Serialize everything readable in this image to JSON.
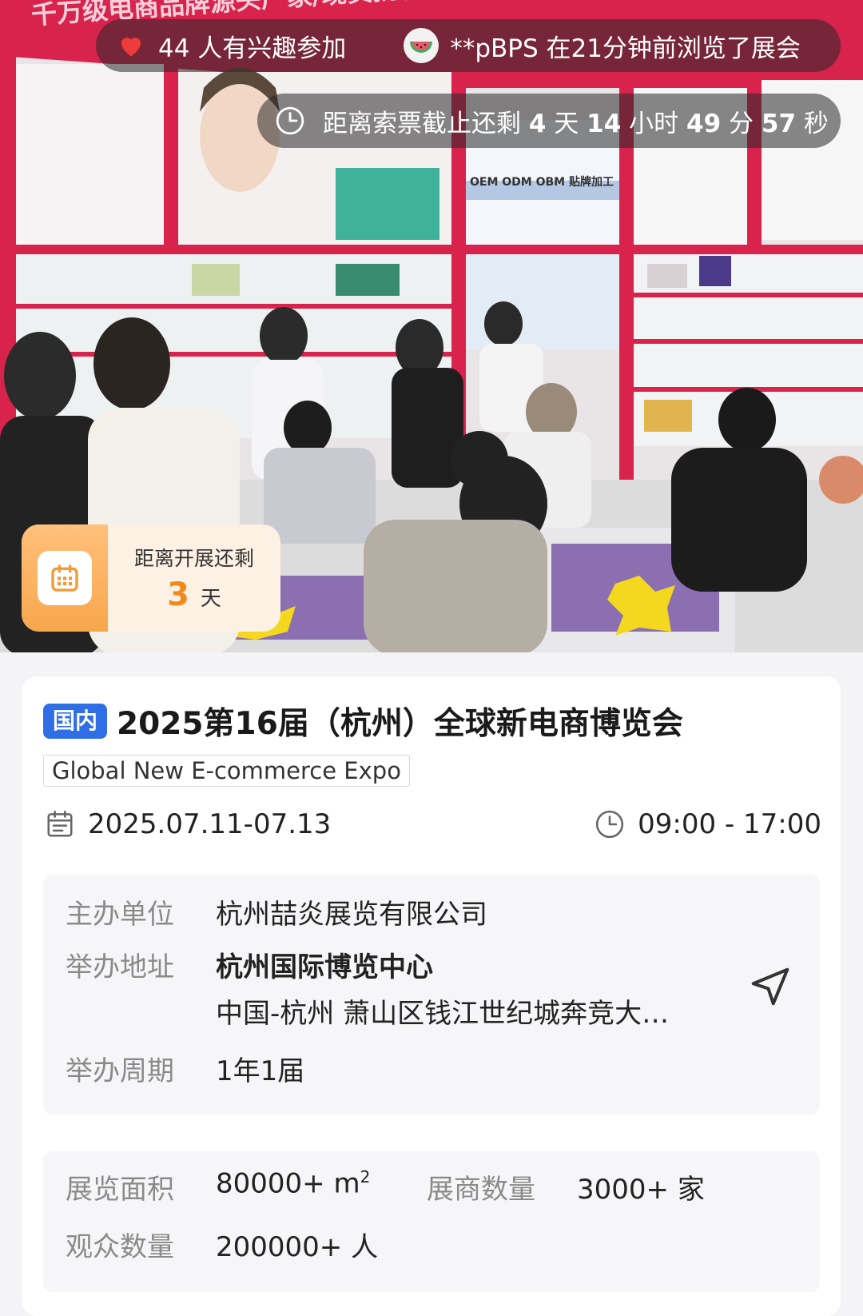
{
  "hero": {
    "interest_count": "44 人有兴趣参加",
    "browse_text": "**pBPS 在21分钟前浏览了展会",
    "ticket_countdown": {
      "prefix": "距离索票截止还剩",
      "days": "4",
      "days_unit": "天",
      "hours": "14",
      "hours_unit": "小时",
      "minutes": "49",
      "minutes_unit": "分",
      "seconds": "57",
      "seconds_unit": "秒"
    },
    "open_countdown": {
      "label": "距离开展还剩",
      "value": "3",
      "unit": "天"
    },
    "photo_banner_text": "千万级电商品牌源头厂家/现货批发/OEM/ODM定制",
    "photo_sign_text": "OEM ODM OBM 贴牌加工"
  },
  "expo": {
    "tag": "国内",
    "title": "2025第16届（杭州）全球新电商博览会",
    "english_name": "Global New E-commerce Expo",
    "date": "2025.07.11-07.13",
    "time": "09:00 - 17:00"
  },
  "info": {
    "organizer_label": "主办单位",
    "organizer": "杭州喆炎展览有限公司",
    "address_label": "举办地址",
    "venue": "杭州国际博览中心",
    "address": "中国-杭州 萧山区钱江世纪城奔竞大…",
    "cycle_label": "举办周期",
    "cycle": "1年1届"
  },
  "stats": {
    "area_label": "展览面积",
    "area": "80000+ m",
    "area_sup": "2",
    "exhibitors_label": "展商数量",
    "exhibitors": "3000+ 家",
    "visitors_label": "观众数量",
    "visitors": "200000+ 人"
  },
  "colors": {
    "tag_blue": "#2f6ee5",
    "countdown_orange": "#f08a1c",
    "booth_red": "#d8234d"
  },
  "icons": [
    "heart-icon",
    "watermelon-avatar",
    "clock-icon",
    "calendar-icon",
    "date-icon",
    "time-icon",
    "navigate-icon"
  ]
}
